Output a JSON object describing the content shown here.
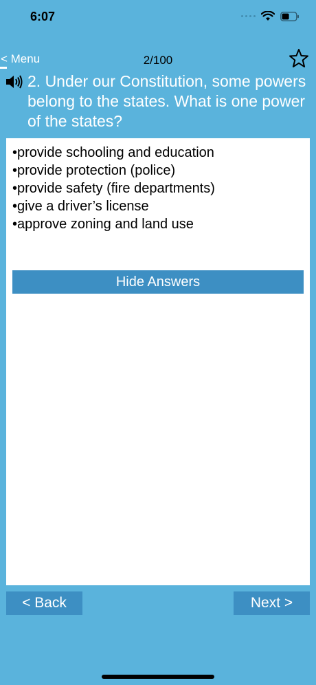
{
  "status_bar": {
    "time": "6:07",
    "icons": [
      "signal-icon",
      "wifi-icon",
      "battery-icon"
    ]
  },
  "nav": {
    "menu_label": "< Menu",
    "progress": "2/100",
    "favorite_icon": "star-outline-icon"
  },
  "question": {
    "speaker_icon": "speaker-icon",
    "text": "2. Under our Constitution, some powers belong to the states. What is one power of the states?"
  },
  "answers": [
    "•provide schooling and education",
    "•provide protection (police)",
    "•provide safety (fire departments)",
    "•give a driver’s license",
    "•approve zoning and land use"
  ],
  "hide_answers_label": "Hide Answers",
  "footer": {
    "back_label": "< Back",
    "next_label": "Next >"
  },
  "colors": {
    "background": "#5ab3dc",
    "button": "#3d8fc3",
    "card": "#ffffff"
  }
}
